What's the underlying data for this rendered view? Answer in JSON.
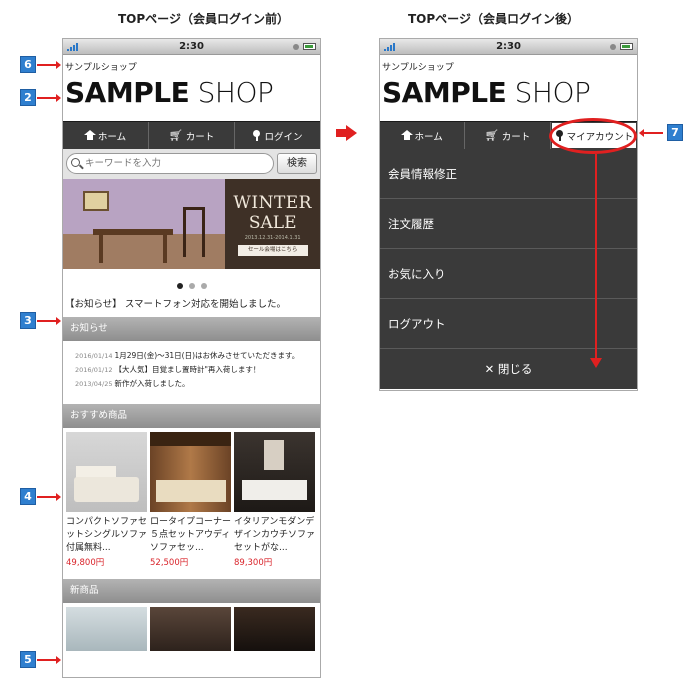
{
  "left_title": "TOPページ（会員ログイン前）",
  "right_title": "TOPページ（会員ログイン後）",
  "status": {
    "time": "2:30"
  },
  "shop": {
    "name_small": "サンプルショップ",
    "logo_bold": "SAMPLE",
    "logo_light": "SHOP"
  },
  "nav_left": {
    "home": "ホーム",
    "cart": "カート",
    "login": "ログイン"
  },
  "nav_right": {
    "home": "ホーム",
    "cart": "カート",
    "account": "マイアカウント"
  },
  "search": {
    "placeholder": "キーワードを入力",
    "button": "検索"
  },
  "banner": {
    "line1": "WINTER",
    "line2": "SALE",
    "date": "2013.12.31-2014.1.31",
    "button": "セール会場はこちら"
  },
  "notice": "【お知らせ】 スマートフォン対応を開始しました。",
  "sections": {
    "news": "お知らせ",
    "recommended": "おすすめ商品",
    "new_items": "新商品"
  },
  "news": [
    {
      "date": "2016/01/14",
      "text": "1月29日(金)〜31日(日)はお休みさせていただきます。"
    },
    {
      "date": "2016/01/12",
      "text": "【大人気】目覚まし置時計\"再入荷します！"
    },
    {
      "date": "2013/04/25",
      "text": "新作が入荷しました。"
    }
  ],
  "products": [
    {
      "name": "コンパクトソファセットシングルソファ付属無料...",
      "price": "49,800円"
    },
    {
      "name": "ロータイプコーナー５点セットアウディソファセッ...",
      "price": "52,500円"
    },
    {
      "name": "イタリアンモダンデザインカウチソファセットがな...",
      "price": "89,300円"
    }
  ],
  "menu": {
    "items": [
      "会員情報修正",
      "注文履歴",
      "お気に入り",
      "ログアウト"
    ],
    "close": "閉じる"
  },
  "badges": {
    "b6": "6",
    "b2": "2",
    "b3": "3",
    "b4": "4",
    "b5": "5",
    "b7": "7"
  },
  "colors": {
    "accent_red": "#e02020",
    "badge_blue": "#2f7fcf",
    "price_red": "#d9232a",
    "nav_dark": "#3a3a3a"
  }
}
